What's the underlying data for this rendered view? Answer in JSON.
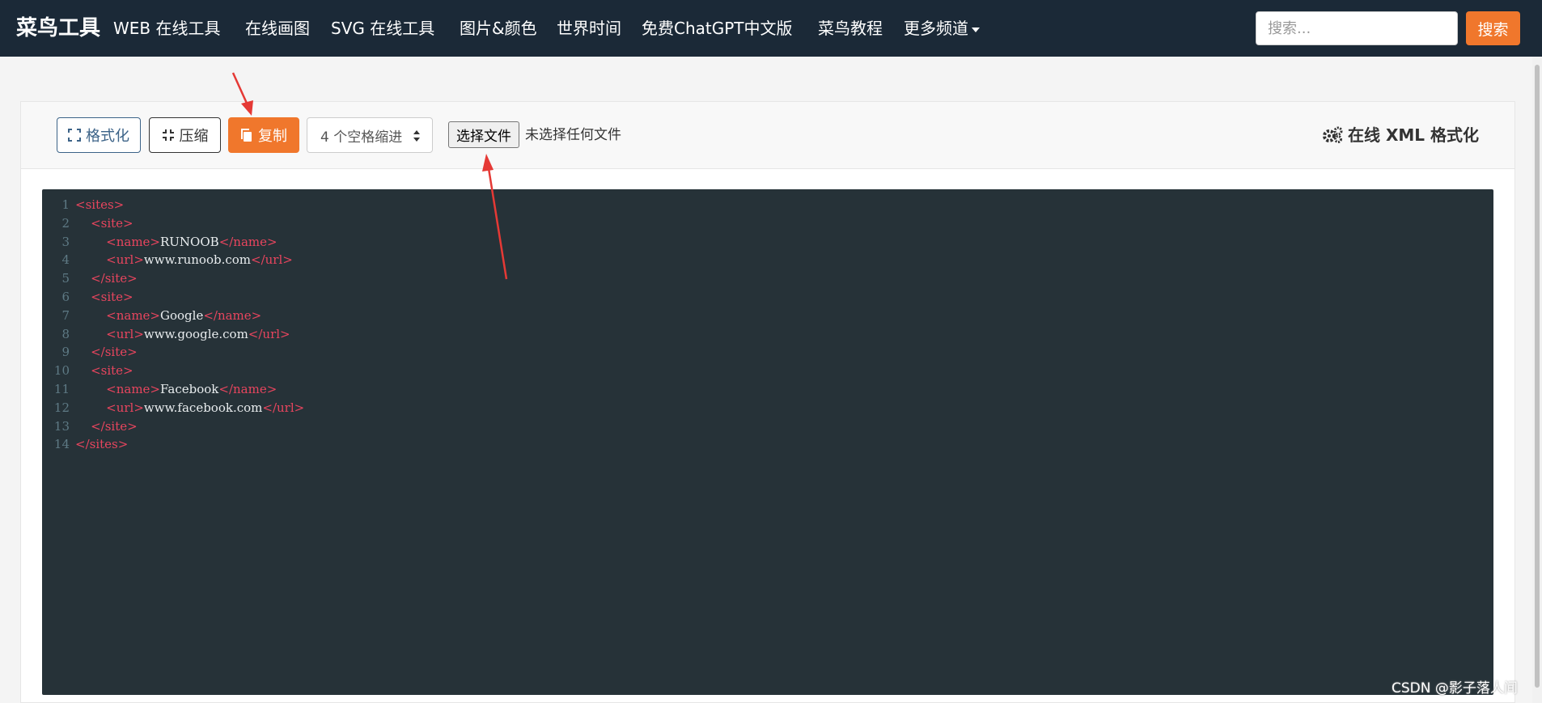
{
  "navbar": {
    "brand": "菜鸟工具",
    "items": [
      {
        "label": "WEB  在线工具"
      },
      {
        "label": "在线画图"
      },
      {
        "label": "SVG  在线工具"
      },
      {
        "label": "图片&颜色"
      },
      {
        "label": "世界时间"
      },
      {
        "label": "免费ChatGPT中文版"
      },
      {
        "label": "菜鸟教程"
      },
      {
        "label": "更多频道"
      }
    ],
    "search_placeholder": "搜索...",
    "search_button": "搜索"
  },
  "toolbar": {
    "format_label": "格式化",
    "compress_label": "压缩",
    "copy_label": "复制",
    "indent_select": "4 个空格缩进",
    "file_button": "选择文件",
    "file_status": "未选择任何文件",
    "title": "在线 XML 格式化"
  },
  "editor": {
    "lines": [
      {
        "num": "1",
        "indent": "",
        "open": "<sites>",
        "text": "",
        "close": ""
      },
      {
        "num": "2",
        "indent": "    ",
        "open": "<site>",
        "text": "",
        "close": ""
      },
      {
        "num": "3",
        "indent": "        ",
        "open": "<name>",
        "text": "RUNOOB",
        "close": "</name>"
      },
      {
        "num": "4",
        "indent": "        ",
        "open": "<url>",
        "text": "www.runoob.com",
        "close": "</url>"
      },
      {
        "num": "5",
        "indent": "    ",
        "open": "</site>",
        "text": "",
        "close": ""
      },
      {
        "num": "6",
        "indent": "    ",
        "open": "<site>",
        "text": "",
        "close": ""
      },
      {
        "num": "7",
        "indent": "        ",
        "open": "<name>",
        "text": "Google",
        "close": "</name>"
      },
      {
        "num": "8",
        "indent": "        ",
        "open": "<url>",
        "text": "www.google.com",
        "close": "</url>"
      },
      {
        "num": "9",
        "indent": "    ",
        "open": "</site>",
        "text": "",
        "close": ""
      },
      {
        "num": "10",
        "indent": "    ",
        "open": "<site>",
        "text": "",
        "close": ""
      },
      {
        "num": "11",
        "indent": "        ",
        "open": "<name>",
        "text": "Facebook",
        "close": "</name>"
      },
      {
        "num": "12",
        "indent": "        ",
        "open": "<url>",
        "text": "www.facebook.com",
        "close": "</url>"
      },
      {
        "num": "13",
        "indent": "    ",
        "open": "</site>",
        "text": "",
        "close": ""
      },
      {
        "num": "14",
        "indent": "",
        "open": "</sites>",
        "text": "",
        "close": ""
      }
    ]
  },
  "watermark": "CSDN @影子落人间",
  "colors": {
    "navbar_bg": "#1b2937",
    "accent_orange": "#f0772c",
    "editor_bg": "#263238",
    "tag_red": "#e8455e",
    "annotation_red": "#e53935"
  }
}
